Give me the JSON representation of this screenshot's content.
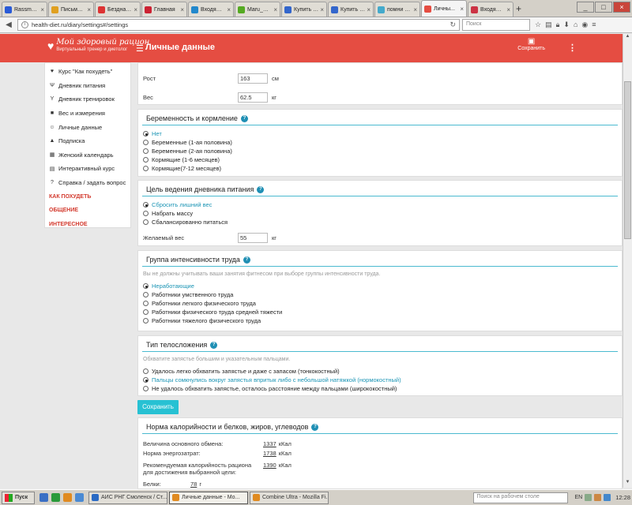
{
  "browser": {
    "tabs": [
      {
        "label": "Rassmol M...",
        "color": "#2a5bd7"
      },
      {
        "label": "Письмо «п...",
        "color": "#e0a020"
      },
      {
        "label": "Бездна го...",
        "color": "#d33"
      },
      {
        "label": "Главная",
        "color": "#cc2233"
      },
      {
        "label": "Входящи...",
        "color": "#2288cc"
      },
      {
        "label": "Maru_Sov...",
        "color": "#55aa22"
      },
      {
        "label": "Купить б...",
        "color": "#3366cc"
      },
      {
        "label": "Купить Xi...",
        "color": "#3366cc"
      },
      {
        "label": "помни нии...",
        "color": "#44aacc"
      },
      {
        "label": "Личны...",
        "color": "#e54d42"
      },
      {
        "label": "Входящи...",
        "color": "#cc3344"
      }
    ],
    "new_tab": "+",
    "url": "health-diet.ru/diary/settings#/settings",
    "search_placeholder": "Поиск"
  },
  "site": {
    "logo_title": "Мой здоровый рацион",
    "logo_subtitle": "Виртуальный тренер и диетолог",
    "page_title": "Личные данные",
    "save_label": "Сохранить"
  },
  "sidebar": {
    "items": [
      {
        "icon": "apple",
        "label": "Курс \"Как похудеть\""
      },
      {
        "icon": "fork",
        "label": "Дневник питания"
      },
      {
        "icon": "dumbbell",
        "label": "Дневник тренировок"
      },
      {
        "icon": "scale",
        "label": "Вес и измерения"
      },
      {
        "icon": "user",
        "label": "Личные данные"
      },
      {
        "icon": "lock",
        "label": "Подписка"
      },
      {
        "icon": "calendar",
        "label": "Женский календарь"
      },
      {
        "icon": "grid",
        "label": "Интерактивный курс"
      },
      {
        "icon": "question",
        "label": "Справка / задать вопрос"
      }
    ],
    "links": [
      "КАК ПОХУДЕТЬ",
      "ОБЩЕНИЕ",
      "ИНТЕРЕСНОЕ"
    ]
  },
  "body": {
    "height_label": "Рост",
    "height_value": "163",
    "height_unit": "см",
    "weight_label": "Вес",
    "weight_value": "62.5",
    "weight_unit": "кг"
  },
  "pregnancy": {
    "title": "Беременность и кормление",
    "options": [
      "Нет",
      "Беременные (1-ая половина)",
      "Беременные (2-ая половина)",
      "Кормящие (1-6 месяцев)",
      "Кормящие(7-12 месяцев)"
    ],
    "selected": 0
  },
  "goal": {
    "title": "Цель ведения дневника питания",
    "options": [
      "Сбросить лишний вес",
      "Набрать массу",
      "Сбалансированно питаться"
    ],
    "selected": 0,
    "target_label": "Желаемый вес",
    "target_value": "55",
    "target_unit": "кг"
  },
  "labor": {
    "title": "Группа интенсивности труда",
    "hint": "Вы не должны учитывать ваши занятия фитнесом при выборе группы интенсивности труда.",
    "options": [
      "Неработающие",
      "Работники умственного труда",
      "Работники легкого физического труда",
      "Работники физического труда средней тяжести",
      "Работники тяжелого физического труда"
    ],
    "selected": 0
  },
  "build": {
    "title": "Тип телосложения",
    "hint": "Обхватите запястье большим и указательным пальцами.",
    "options": [
      "Удалось легко обхватить запястье и даже с запасом (тонкокостный)",
      "Пальцы сомкнулись вокруг запястья впритык либо с небольшой натяжкой (нормокостный)",
      "Не удалось обхватить запястье, осталось расстояние между пальцами (ширококостный)"
    ],
    "selected": 1
  },
  "save_button": "Сохранить",
  "norms": {
    "title": "Норма калорийности и белков, жиров, углеводов",
    "rows": [
      {
        "label": "Величина основного обмена:",
        "value": "1337",
        "unit": "кКал"
      },
      {
        "label": "Норма энергозатрат:",
        "value": "1738",
        "unit": "кКал"
      },
      {
        "label": "Рекомендуемая калорийность рациона для достижения выбранной цели:",
        "value": "1390",
        "unit": "кКал"
      }
    ],
    "protein_label": "Белки:",
    "protein_value": "78",
    "protein_unit": "г"
  },
  "taskbar": {
    "start": "Пуск",
    "buttons": [
      {
        "label": "АИС РНГ Смоленск / Ст...",
        "active": false
      },
      {
        "label": "Личные данные - Mo...",
        "active": true
      },
      {
        "label": "Combine Ultra - Mozilla Fi...",
        "active": false
      }
    ],
    "search_placeholder": "Поиск на рабочем столе",
    "lang": "EN",
    "clock": "12:28"
  }
}
